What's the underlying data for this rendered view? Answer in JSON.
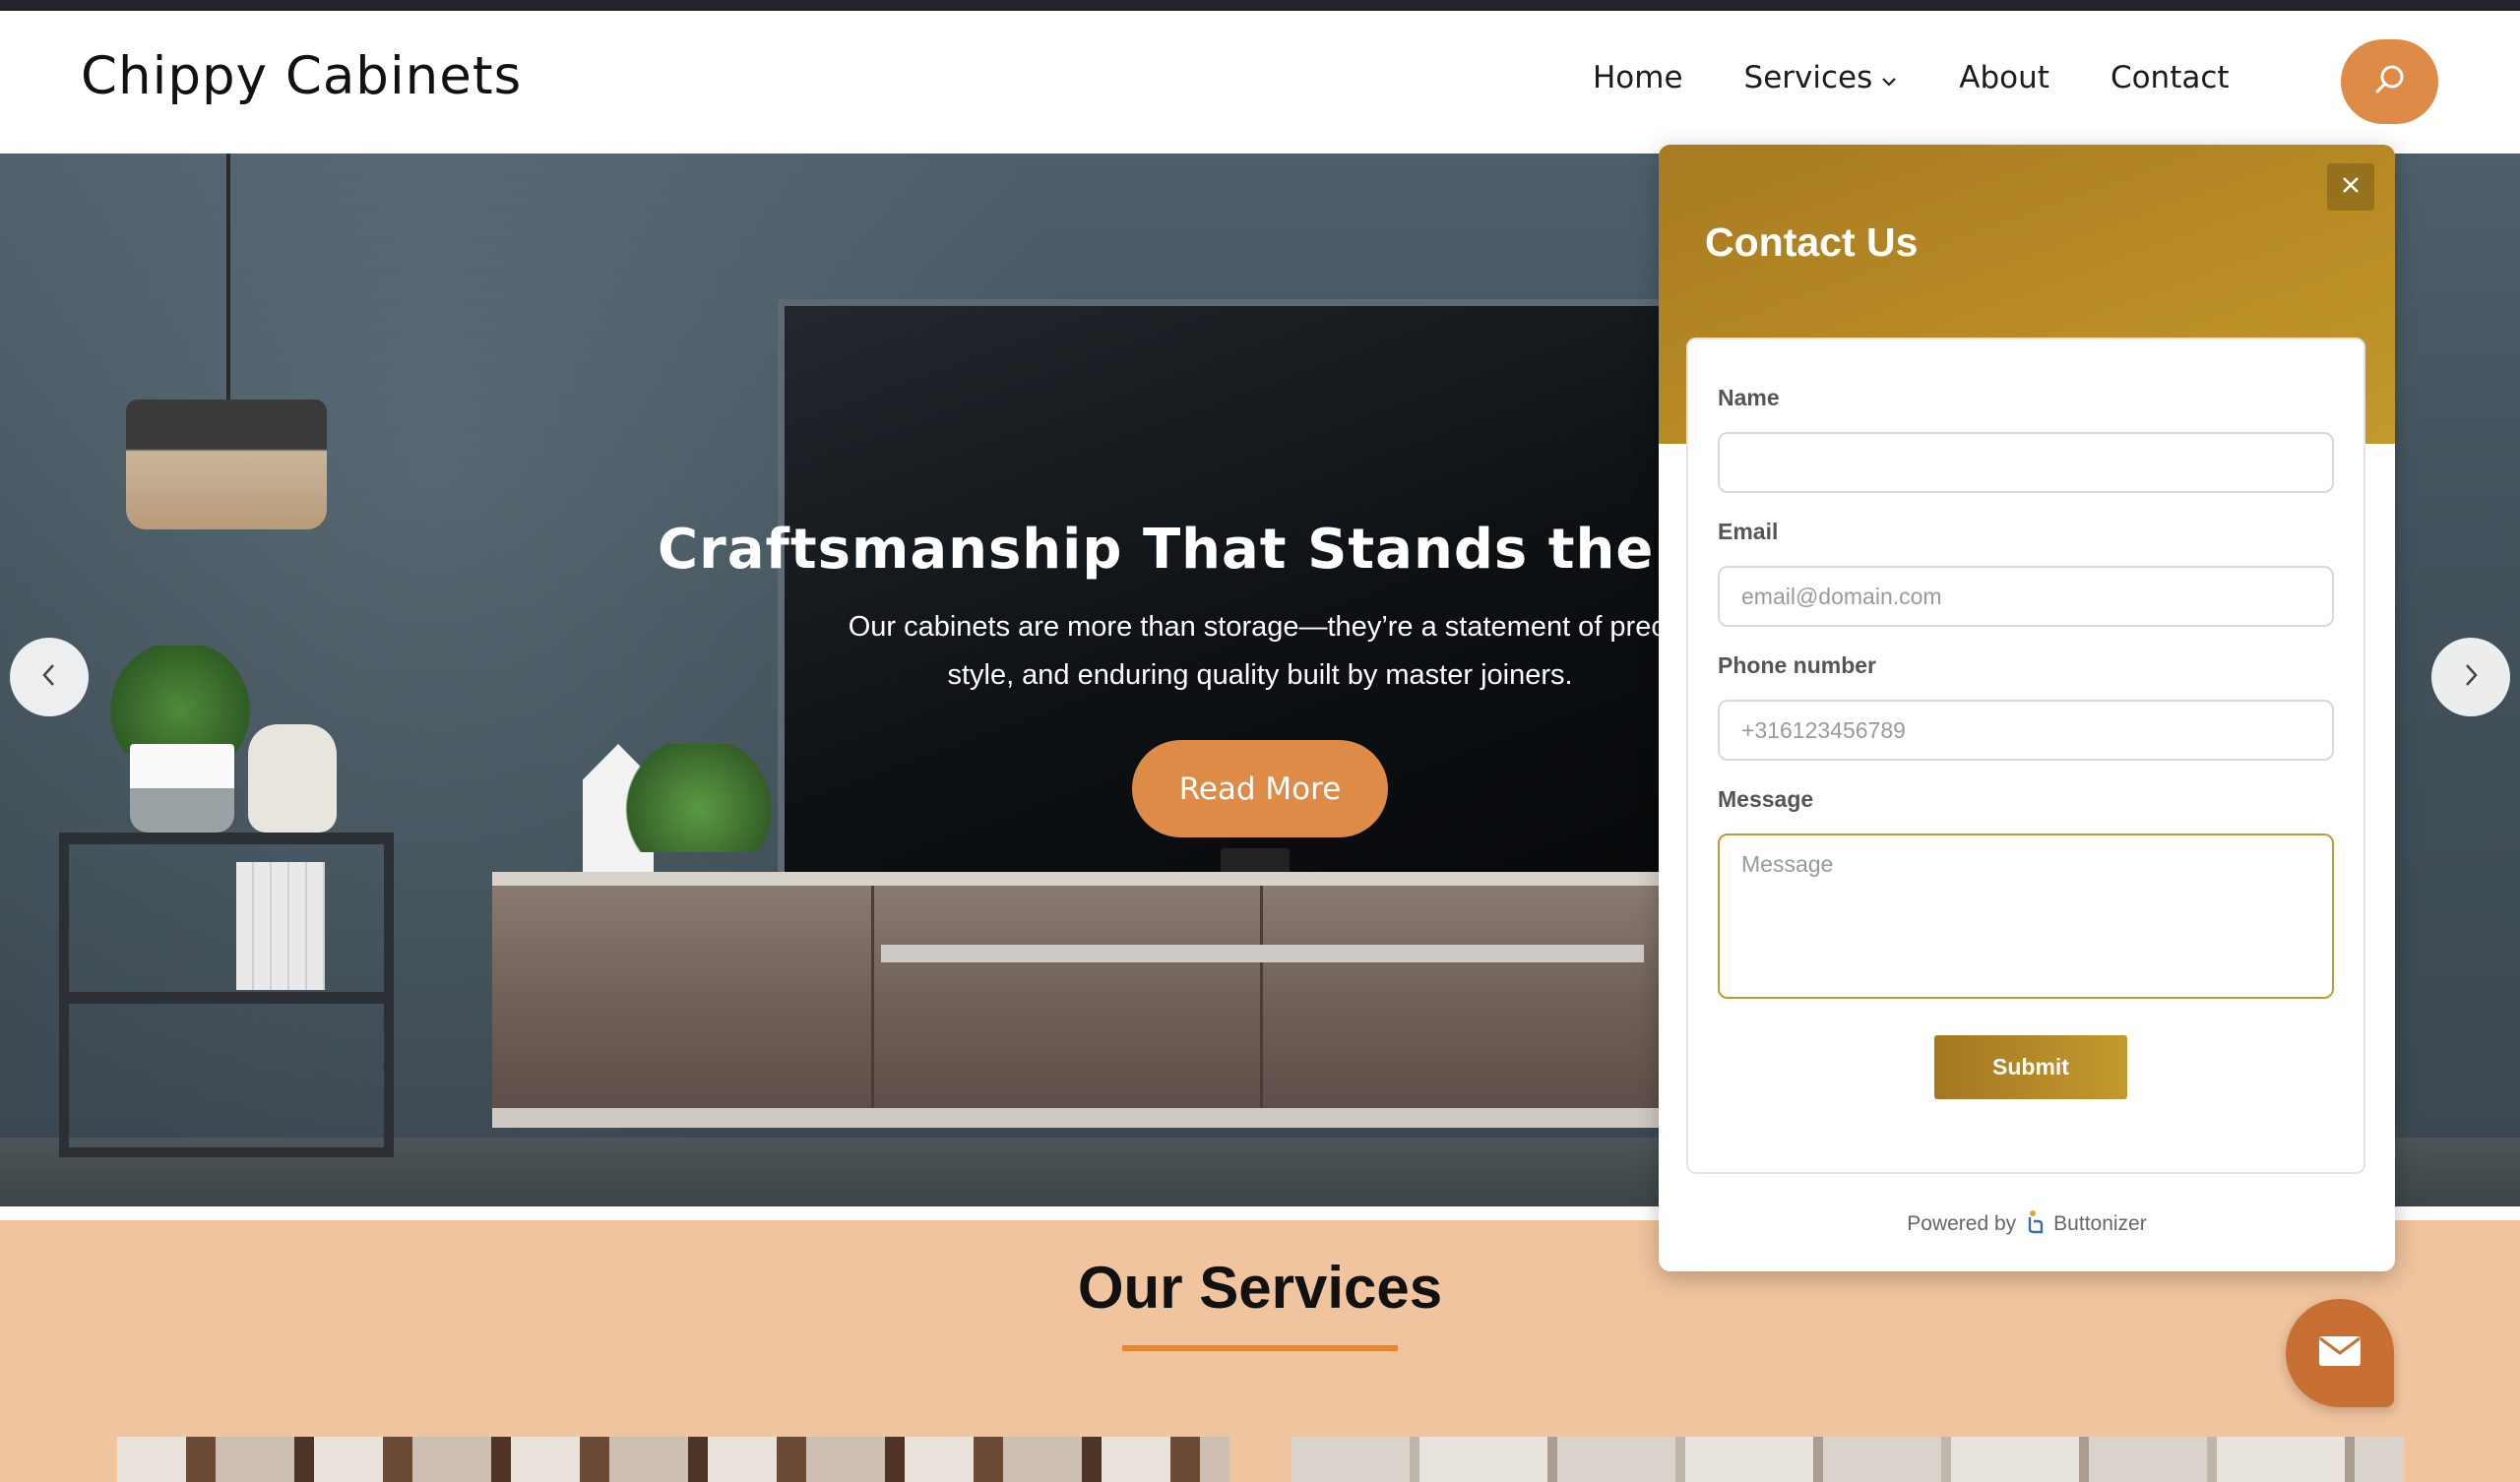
{
  "site": {
    "logo": "Chippy Cabinets",
    "nav": [
      {
        "label": "Home"
      },
      {
        "label": "Services",
        "has_dropdown": true
      },
      {
        "label": "About"
      },
      {
        "label": "Contact"
      }
    ],
    "search_icon": "search-icon",
    "accent_color": "#dd8b47"
  },
  "hero": {
    "title": "Craftsmanship That Stands the Test",
    "subtitle": "Our cabinets are more than storage—they’re a statement of preci\nstyle, and enduring quality built by master joiners.",
    "cta_label": "Read More",
    "prev_icon": "chevron-left-icon",
    "next_icon": "chevron-right-icon"
  },
  "services": {
    "title": "Our Services",
    "background_color": "#f0c49e"
  },
  "contact_panel": {
    "title": "Contact Us",
    "close_icon": "close-icon",
    "fields": {
      "name": {
        "label": "Name",
        "placeholder": "",
        "value": ""
      },
      "email": {
        "label": "Email",
        "placeholder": "email@domain.com",
        "value": ""
      },
      "phone": {
        "label": "Phone number",
        "placeholder": "+316123456789",
        "value": ""
      },
      "message": {
        "label": "Message",
        "placeholder": "Message",
        "value": ""
      }
    },
    "submit_label": "Submit",
    "powered_by": "Powered by",
    "brand": "Buttonizer",
    "header_color": "#b88b24"
  },
  "fab": {
    "icon": "envelope-icon"
  }
}
